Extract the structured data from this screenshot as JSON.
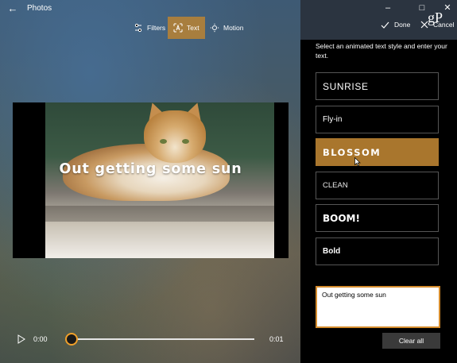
{
  "app": {
    "title": "Photos",
    "watermark": "gP"
  },
  "toolbar": {
    "filters_label": "Filters",
    "text_label": "Text",
    "motion_label": "Motion",
    "done_label": "Done",
    "cancel_label": "Cancel"
  },
  "preview": {
    "overlay_text": "Out getting some sun"
  },
  "playback": {
    "current_time": "0:00",
    "end_time": "0:01",
    "progress": 0
  },
  "panel": {
    "instruction": "Select an animated text style and enter your text.",
    "styles": [
      {
        "label": "SUNRISE",
        "selected": false
      },
      {
        "label": "Fly-in",
        "selected": false
      },
      {
        "label": "BLOSSOM",
        "selected": true
      },
      {
        "label": "CLEAN",
        "selected": false
      },
      {
        "label": "BOOM!",
        "selected": false
      },
      {
        "label": "Bold",
        "selected": false
      }
    ],
    "text_value": "Out getting some sun",
    "clear_label": "Clear all"
  },
  "colors": {
    "accent": "#a9762d",
    "input_border": "#d48b2c",
    "panel_bg": "#000000"
  }
}
